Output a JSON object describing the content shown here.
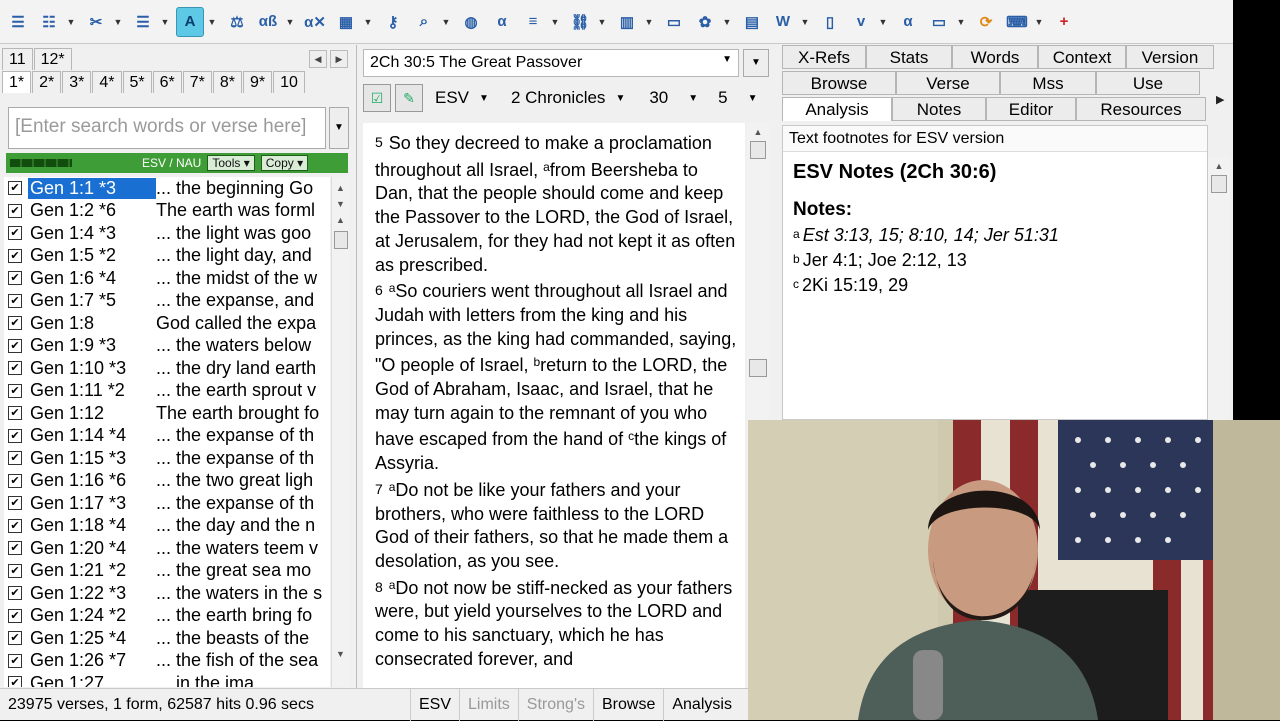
{
  "toolbar": {
    "icons": [
      "toggle-left-icon",
      "toggle-panels-icon",
      "tools-icon",
      "notes-doc-icon",
      "text-format-icon",
      "scales-icon",
      "search-word-icon",
      "search-alpha-icon",
      "map-icon",
      "key-icon",
      "magnify-icon",
      "globe-icon",
      "alpha-doc-icon",
      "books-icon",
      "link-icon",
      "chart-icon",
      "window-icon",
      "colors-icon",
      "layout-icon",
      "word-doc-icon",
      "pages-icon",
      "verse-doc-icon",
      "alpha-icon",
      "screen-icon",
      "refresh-icon",
      "keyboard-icon",
      "add-icon"
    ],
    "active_label": "A"
  },
  "left": {
    "tabs_row1": [
      "11",
      "12*"
    ],
    "tabs_row2": [
      "1*",
      "2*",
      "3*",
      "4*",
      "5*",
      "6*",
      "7*",
      "8*",
      "9*",
      "10"
    ],
    "search_placeholder": "[Enter search words or verse here]",
    "version_label": "ESV / NAU",
    "tools_label": "Tools",
    "copy_label": "Copy",
    "results": [
      {
        "ref": "Gen 1:1 *3",
        "snip": "... the beginning Go"
      },
      {
        "ref": "Gen 1:2 *6",
        "snip": "The earth was forml"
      },
      {
        "ref": "Gen 1:4 *3",
        "snip": "... the light was goo"
      },
      {
        "ref": "Gen 1:5 *2",
        "snip": "... the light day, and"
      },
      {
        "ref": "Gen 1:6 *4",
        "snip": "... the midst of the w"
      },
      {
        "ref": "Gen 1:7 *5",
        "snip": "... the expanse, and"
      },
      {
        "ref": "Gen 1:8",
        "snip": "God called the expa"
      },
      {
        "ref": "Gen 1:9 *3",
        "snip": "... the waters below"
      },
      {
        "ref": "Gen 1:10 *3",
        "snip": "... the dry land earth"
      },
      {
        "ref": "Gen 1:11 *2",
        "snip": "... the earth sprout v"
      },
      {
        "ref": "Gen 1:12",
        "snip": "The earth brought fo"
      },
      {
        "ref": "Gen 1:14 *4",
        "snip": "... the expanse of th"
      },
      {
        "ref": "Gen 1:15 *3",
        "snip": "... the expanse of th"
      },
      {
        "ref": "Gen 1:16 *6",
        "snip": "... the two great ligh"
      },
      {
        "ref": "Gen 1:17 *3",
        "snip": "... the expanse of th"
      },
      {
        "ref": "Gen 1:18 *4",
        "snip": "... the day and the n"
      },
      {
        "ref": "Gen 1:20 *4",
        "snip": "... the waters teem v"
      },
      {
        "ref": "Gen 1:21 *2",
        "snip": "... the great sea mo"
      },
      {
        "ref": "Gen 1:22 *3",
        "snip": "... the waters in the s"
      },
      {
        "ref": "Gen 1:24 *2",
        "snip": "... the earth bring fo"
      },
      {
        "ref": "Gen 1:25 *4",
        "snip": "... the beasts of the"
      },
      {
        "ref": "Gen 1:26 *7",
        "snip": "... the fish of the sea"
      },
      {
        "ref": "Gen 1:27",
        "snip": "... in the ima"
      }
    ]
  },
  "middle": {
    "title": "2Ch 30:5 The Great Passover",
    "version": "ESV",
    "book": "2 Chronicles",
    "chapter": "30",
    "verse": "5",
    "verses": [
      {
        "num": "5",
        "text": "So they decreed to make a proclamation throughout all Israel, ",
        "fn": "a",
        "rest": "from Beersheba to Dan, that the people should come and keep the Passover to the LORD, the God of Israel, at Jerusalem, for they had not kept it as often as prescribed."
      },
      {
        "num": "6",
        "fn": "a",
        "text": "So couriers went throughout all Israel and Judah with letters from the king and his princes, as the king had commanded, saying, \"O people of Israel, ",
        "fn2": "b",
        "rest": "return to the LORD, the God of Abraham, Isaac, and Israel, that he may turn again to the remnant of you who have escaped from the hand of ",
        "fn3": "c",
        "rest2": "the kings of Assyria."
      },
      {
        "num": "7",
        "fn": "a",
        "text": "Do not be like your fathers and your brothers, who were faithless to the LORD God of their fathers, so that he made them a desolation, as you see."
      },
      {
        "num": "8",
        "fn": "a",
        "text": "Do not now be stiff-necked as your fathers were, but yield yourselves to the LORD and come to his sanctuary, which he has consecrated forever, and"
      }
    ]
  },
  "right": {
    "tabs_row1": [
      "X-Refs",
      "Stats",
      "Words",
      "Context",
      "Version"
    ],
    "tabs_row2": [
      "Browse",
      "Verse",
      "Mss",
      "Use"
    ],
    "tabs_row3": [
      "Analysis",
      "Notes",
      "Editor",
      "Resources"
    ],
    "header": "Text footnotes for ESV version",
    "notes_title": "ESV Notes (2Ch 30:6)",
    "notes_label": "Notes:",
    "notes": [
      {
        "mark": "a",
        "text": "Est 3:13, 15; 8:10, 14; Jer 51:31",
        "italic": true
      },
      {
        "mark": "b",
        "text": "Jer 4:1; Joe 2:12, 13",
        "italic": false
      },
      {
        "mark": "c",
        "text": "2Ki 15:19, 29",
        "italic": false
      }
    ]
  },
  "status": {
    "summary": "23975 verses, 1 form, 62587 hits 0.96 secs",
    "items": [
      "ESV",
      "Limits",
      "Strong's",
      "Browse",
      "Analysis"
    ]
  },
  "colors": {
    "green_bar": "#3f9d38",
    "selection": "#1a6fd3",
    "highlight": "#fff7a8",
    "active_tool": "#5ec9e6"
  }
}
